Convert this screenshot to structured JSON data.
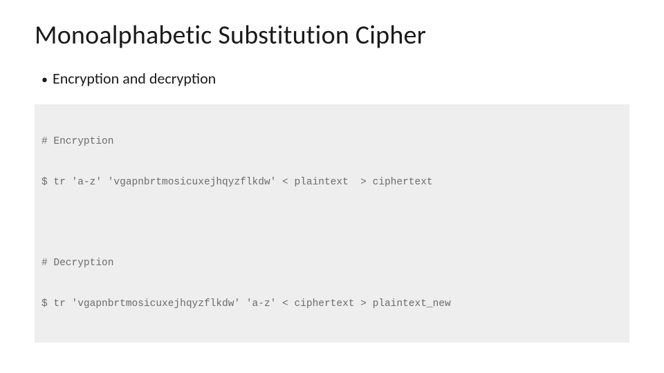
{
  "title": "Monoalphabetic Substitution Cipher",
  "bullet": {
    "text": "Encryption and decryption"
  },
  "code": {
    "lines": [
      "# Encryption",
      "$ tr 'a-z' 'vgapnbrtmosicuxejhqyzflkdw' < plaintext  > ciphertext",
      "",
      "# Decryption",
      "$ tr 'vgapnbrtmosicuxejhqyzflkdw' 'a-z' < ciphertext > plaintext_new"
    ]
  }
}
